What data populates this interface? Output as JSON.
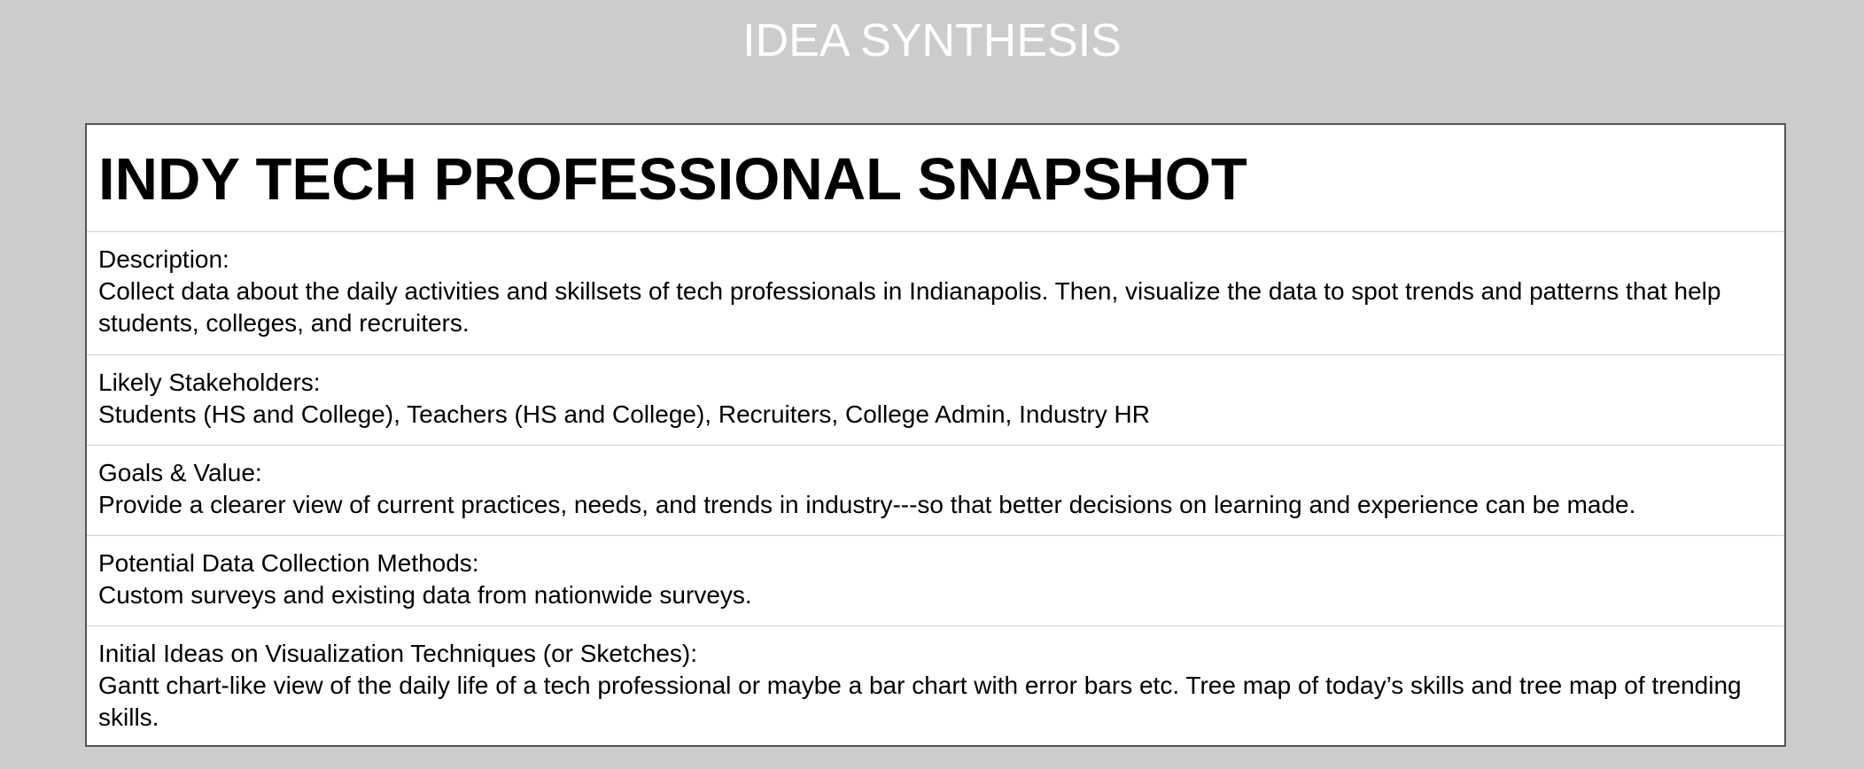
{
  "header": {
    "title": "IDEA SYNTHESIS"
  },
  "card": {
    "title": "INDY TECH PROFESSIONAL SNAPSHOT",
    "sections": [
      {
        "label": "Description:",
        "body": "Collect data about the daily activities and skillsets of tech professionals in Indianapolis. Then, visualize the data to spot trends and patterns that help students, colleges, and recruiters."
      },
      {
        "label": "Likely Stakeholders:",
        "body": "Students (HS and College), Teachers (HS and College), Recruiters, College Admin, Industry HR"
      },
      {
        "label": "Goals & Value:",
        "body": "Provide a clearer view of current practices, needs, and trends in industry---so that better decisions on learning and experience can be made."
      },
      {
        "label": "Potential Data Collection Methods:",
        "body": "Custom surveys and existing data from nationwide surveys."
      },
      {
        "label": "Initial Ideas on Visualization Techniques (or Sketches):",
        "body": "Gantt chart-like view of the daily life of a tech professional or maybe a bar chart with error bars etc. Tree map of today’s skills and tree map of trending skills."
      }
    ]
  },
  "colors": {
    "background": "#cccccc",
    "header_text": "#ffffff",
    "card_background": "#ffffff",
    "card_border": "#555555",
    "divider": "#cfcfcf",
    "text": "#000000"
  }
}
